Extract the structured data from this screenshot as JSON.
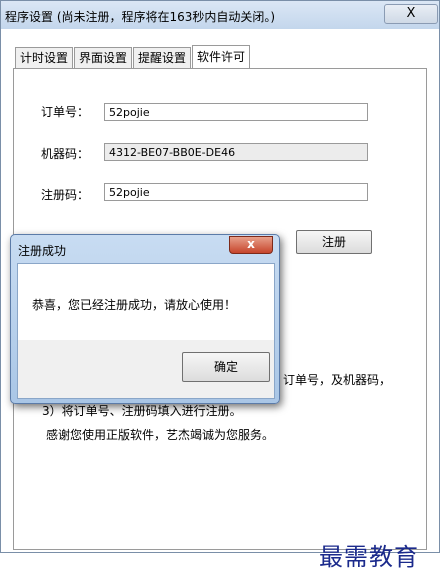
{
  "window": {
    "title": "程序设置 (尚未注册，程序将在163秒内自动关闭。)",
    "close_label": "X"
  },
  "tabs": [
    "计时设置",
    "界面设置",
    "提醒设置",
    "软件许可"
  ],
  "license": {
    "order_label": "订单号：",
    "order_value": "52pojie",
    "machine_label": "机器码：",
    "machine_value": "4312-BE07-BB0E-DE46",
    "reg_label": "注册码：",
    "reg_value": "52pojie",
    "register_button": "注册"
  },
  "info": {
    "line_partial": "订单号，及机器码，",
    "line_3": "3）将订单号、注册码填入进行注册。",
    "thanks": "感谢您使用正版软件，艺杰竭诚为您服务。"
  },
  "dialog": {
    "title": "注册成功",
    "close_label": "x",
    "message": "恭喜，您已经注册成功，请放心使用！",
    "ok_button": "确定"
  },
  "watermark": "最需教育"
}
